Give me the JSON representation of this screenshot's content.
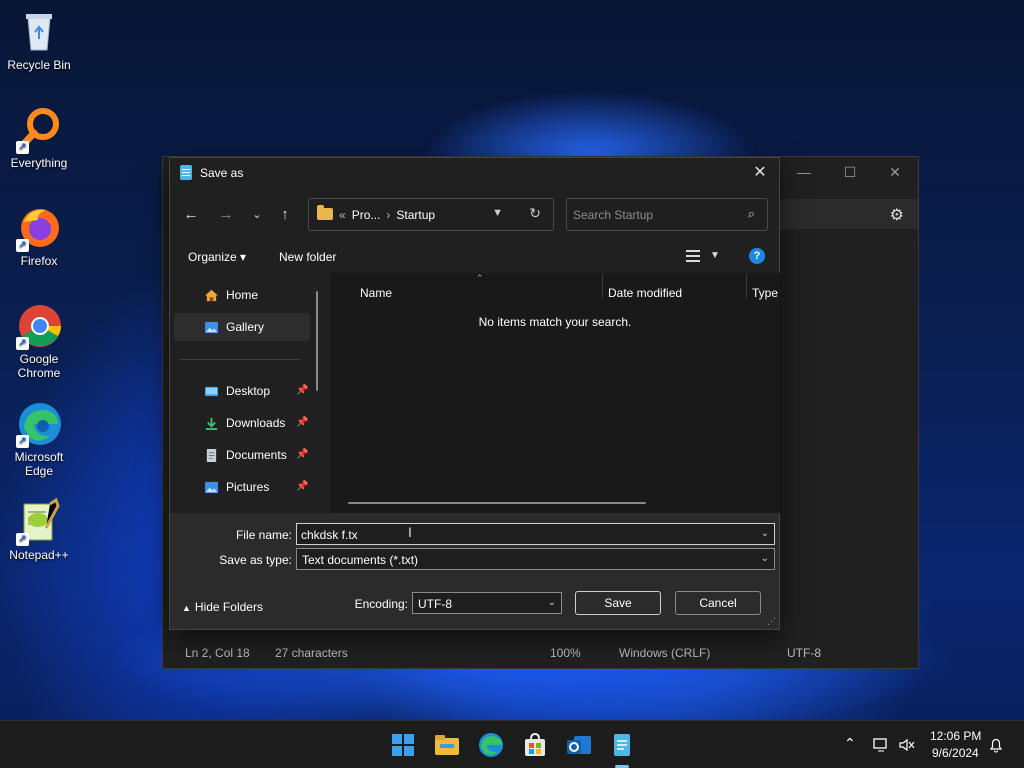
{
  "desktop": {
    "icons": [
      {
        "label": "Recycle Bin"
      },
      {
        "label": "Everything"
      },
      {
        "label": "Firefox"
      },
      {
        "label": "Google Chrome"
      },
      {
        "label": "Microsoft Edge"
      },
      {
        "label": "Notepad++"
      }
    ]
  },
  "notepad": {
    "status": {
      "position": "Ln 2, Col 18",
      "chars": "27 characters",
      "zoom": "100%",
      "line_ending": "Windows (CRLF)",
      "encoding": "UTF-8"
    }
  },
  "dialog": {
    "title": "Save as",
    "close": "✕",
    "address": {
      "prefix": "«",
      "crumb1": "Pro...",
      "sep": "›",
      "crumb2": "Startup"
    },
    "search_placeholder": "Search Startup",
    "toolbar": {
      "organize": "Organize ▾",
      "new_folder": "New folder",
      "help": "?"
    },
    "nav": [
      {
        "label": "Home"
      },
      {
        "label": "Gallery"
      },
      {
        "label": "Desktop"
      },
      {
        "label": "Downloads"
      },
      {
        "label": "Documents"
      },
      {
        "label": "Pictures"
      }
    ],
    "columns": {
      "name": "Name",
      "date": "Date modified",
      "type": "Type"
    },
    "empty_message": "No items match your search.",
    "file_name_label": "File name:",
    "file_name_value": "chkdsk f.tx",
    "save_type_label": "Save as type:",
    "save_type_value": "Text documents (*.txt)",
    "hide_folders": "Hide Folders",
    "encoding_label": "Encoding:",
    "encoding_value": "UTF-8",
    "save": "Save",
    "cancel": "Cancel"
  },
  "taskbar": {
    "time": "12:06 PM",
    "date": "9/6/2024"
  },
  "colors": {
    "accent": "#1e88e5",
    "dialog_bg": "#202020",
    "footer_bg": "#2b2b2b"
  }
}
